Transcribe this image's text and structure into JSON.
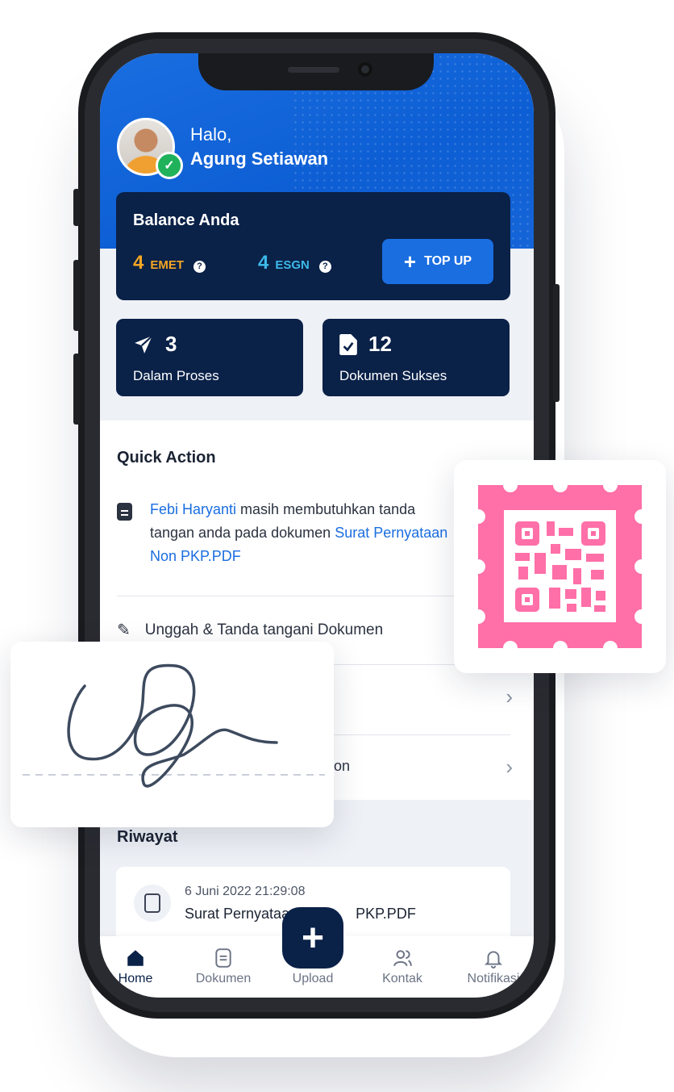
{
  "greeting": {
    "hello": "Halo,",
    "name": "Agung Setiawan"
  },
  "balance": {
    "title": "Balance Anda",
    "emet_value": "4",
    "emet_unit": "EMET",
    "esgn_value": "4",
    "esgn_unit": "ESGN",
    "topup_label": "TOP UP",
    "emet_color": "#f5a623",
    "esgn_color": "#3db8e8"
  },
  "stats": [
    {
      "count": "3",
      "label": "Dalam Proses",
      "icon": "send-icon"
    },
    {
      "count": "12",
      "label": "Dokumen Sukses",
      "icon": "document-check-icon"
    }
  ],
  "quick_action": {
    "title": "Quick Action",
    "request": {
      "person": "Febi Haryanti",
      "text": " masih membutuhkan tanda tangan anda pada dokumen ",
      "document": "Surat Pernyataan Non PKP.PDF"
    },
    "upload_sign": "Unggah & Tanda tangani Dokumen",
    "partial_item": "on"
  },
  "riwayat": {
    "title": "Riwayat",
    "item": {
      "date": "6 Juni 2022  21:29:08",
      "name_start": "Surat Pernyataa",
      "name_end": "PKP.PDF"
    }
  },
  "nav": {
    "home": "Home",
    "dokumen": "Dokumen",
    "upload": "Upload",
    "kontak": "Kontak",
    "notifikasi": "Notifikasi"
  },
  "colors": {
    "primary": "#1a6ee0",
    "navy": "#0a2148",
    "qr_pink": "#ff6fa8"
  }
}
